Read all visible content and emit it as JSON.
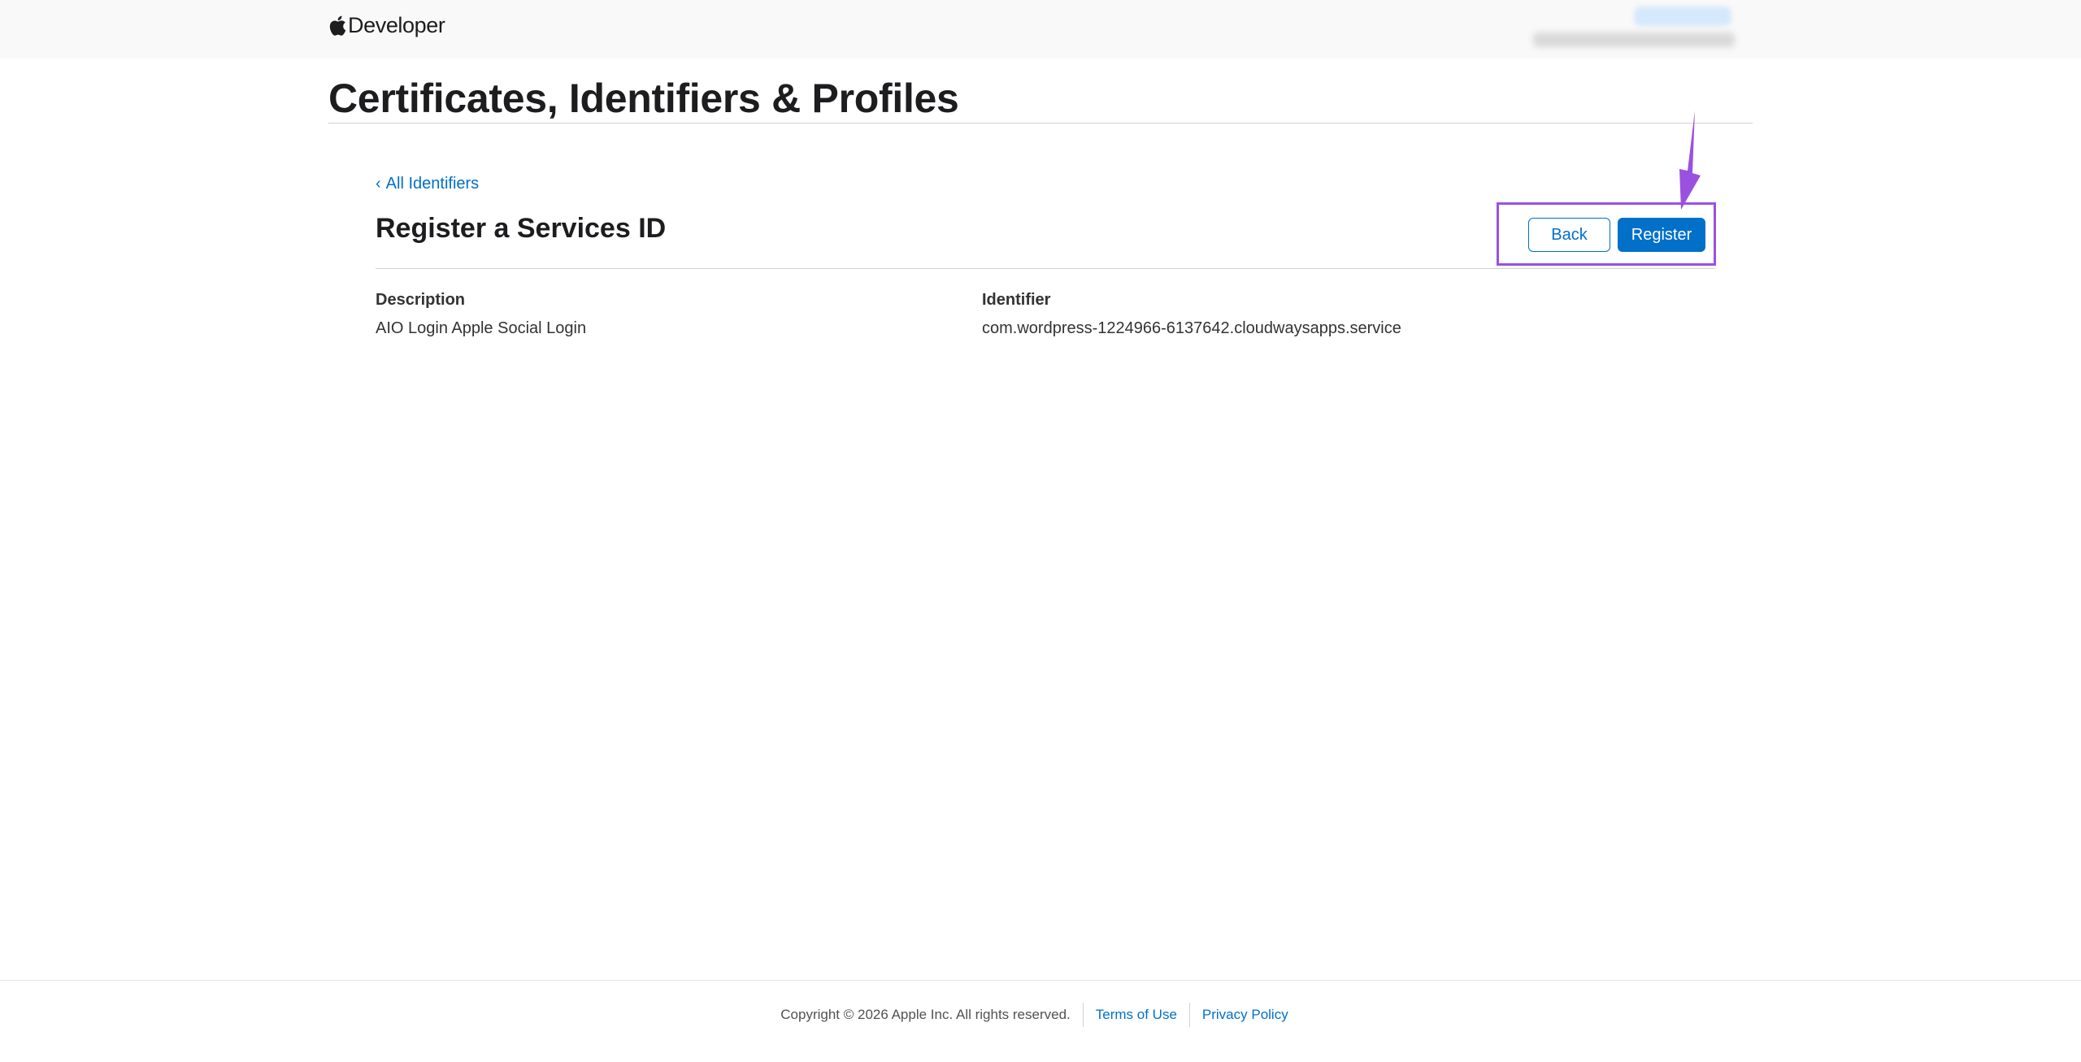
{
  "nav": {
    "brand": "Developer"
  },
  "page": {
    "title": "Certificates, Identifiers & Profiles"
  },
  "form": {
    "back_link": "All Identifiers",
    "title": "Register a Services ID",
    "back_button": "Back",
    "register_button": "Register",
    "fields": [
      {
        "label": "Description",
        "value": "AIO Login Apple Social Login"
      },
      {
        "label": "Identifier",
        "value": "com.wordpress-1224966-6137642.cloudwaysapps.service"
      }
    ]
  },
  "annotation": {
    "highlight_color": "#9b51e0",
    "arrow_color": "#9b51e0"
  },
  "footer": {
    "copyright": "Copyright © 2026 Apple Inc. All rights reserved.",
    "links": [
      "Terms of Use",
      "Privacy Policy"
    ]
  },
  "colors": {
    "accent": "#0070c9",
    "text": "#1d1d1f"
  }
}
